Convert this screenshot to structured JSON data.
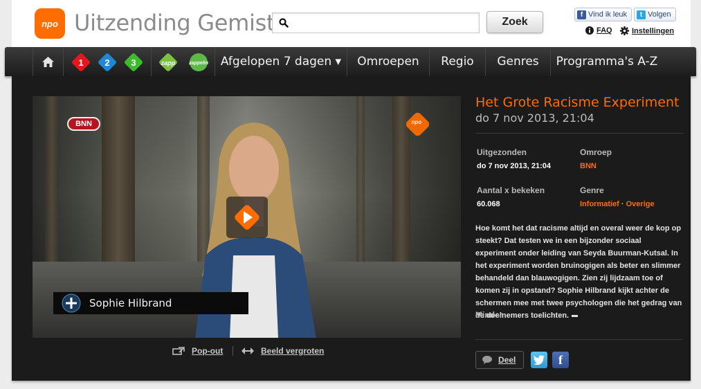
{
  "header": {
    "logo_text": "npo",
    "site_title": "Uitzending Gemist",
    "search_placeholder": "",
    "search_value": "",
    "search_button": "Zoek",
    "fb_like": "Vind ik leuk",
    "tw_follow": "Volgen",
    "faq": "FAQ",
    "settings": "Instellingen"
  },
  "nav": {
    "channels": [
      "1",
      "2",
      "3",
      "zapp",
      "zappelin"
    ],
    "items": [
      {
        "label": "Afgelopen 7 dagen ▾"
      },
      {
        "label": "Omroepen"
      },
      {
        "label": "Regio"
      },
      {
        "label": "Genres"
      },
      {
        "label": "Programma's A-Z"
      }
    ]
  },
  "player": {
    "broadcaster_logo": "BNN",
    "watermark": "npo",
    "presenter_name": "Sophie Hilbrand",
    "popout": "Pop-out",
    "enlarge": "Beeld vergroten"
  },
  "episode": {
    "title": "Het Grote Racisme Experiment",
    "date": "do 7 nov 2013, 21:04",
    "aired_label": "Uitgezonden",
    "aired_value": "do 7 nov 2013, 21:04",
    "broadcaster_label": "Omroep",
    "broadcaster_value": "BNN",
    "views_label": "Aantal x bekeken",
    "views_value": "60.068",
    "genre_label": "Genre",
    "genre_1": "Informatief",
    "genre_sep": " · ",
    "genre_2": "Overige",
    "description": "Hoe komt het dat racisme altijd en overal weer de kop op steekt? Dat testen we in een bijzonder sociaal experiment onder leiding van Seyda Buurman-Kutsal. In het experiment worden bruinogigen als beter en slimmer behandeld dan blauwogigen. Zien zij lijdzaam toe of komen zij in opstand? Sophie Hilbrand kijkt achter de schermen mee met twee psychologen die het gedrag van de deelnemers toelichten.",
    "less": "Minder",
    "share": "Deel"
  },
  "colors": {
    "accent": "#ff6d00",
    "panel": "#1b1b1b",
    "nav": "#2a2a2a"
  }
}
